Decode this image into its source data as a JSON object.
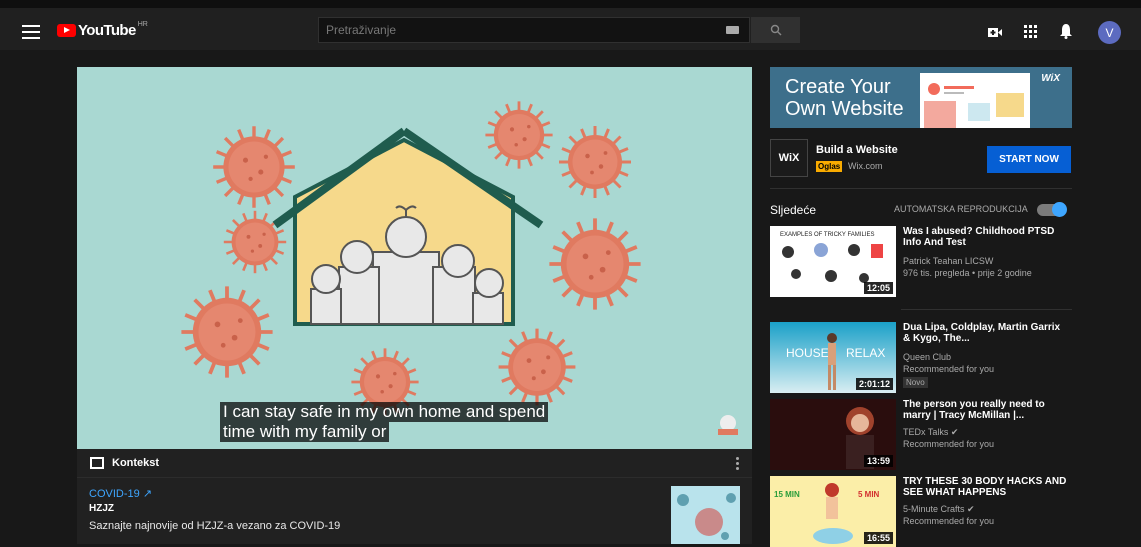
{
  "header": {
    "logo_text": "YouTube",
    "region": "HR",
    "search_placeholder": "Pretraživanje",
    "avatar_letter": "V",
    "icons": [
      "menu-icon",
      "keyboard-icon",
      "search-icon",
      "create-video-icon",
      "apps-icon",
      "notifications-icon"
    ]
  },
  "player": {
    "caption_line1": "I can stay safe in my own home and spend",
    "caption_line2": "time with my family or"
  },
  "context": {
    "heading": "Kontekst",
    "link": "COVID-19",
    "source": "HZJZ",
    "description": "Saznajte najnovije od HZJZ-a vezano za COVID-19"
  },
  "ad": {
    "banner_text": "Create Your Own Website",
    "banner_brand": "WiX",
    "logo_text": "WiX",
    "title": "Build a Website",
    "badge": "Oglas",
    "domain": "Wix.com",
    "cta": "START NOW"
  },
  "up_next": {
    "label": "Sljedeće",
    "autoplay_label": "AUTOMATSKA REPRODUKCIJA",
    "autoplay_on": true
  },
  "recommendations": [
    {
      "title": "Was I abused? Childhood PTSD Info And Test",
      "channel": "Patrick Teahan LICSW",
      "meta": "976 tis. pregleda • prije 2 godine",
      "duration": "12:05",
      "thumb_caption": "EXAMPLES OF TRICKY FAMILIES"
    },
    {
      "title": "Dua Lipa, Coldplay, Martin Garrix & Kygo, The...",
      "channel": "Queen Club",
      "meta": "Recommended for you",
      "badge": "Novo",
      "duration": "2:01:12",
      "thumb_left": "HOUSE",
      "thumb_right": "RELAX"
    },
    {
      "title": "The person you really need to marry | Tracy McMillan |...",
      "channel": "TEDx Talks",
      "meta": "Recommended for you",
      "duration": "13:59",
      "verified": true
    },
    {
      "title": "TRY THESE 30 BODY HACKS AND SEE WHAT HAPPENS",
      "channel": "5-Minute Crafts",
      "meta": "Recommended for you",
      "duration": "16:55",
      "verified": true,
      "thumb_left": "15 MIN",
      "thumb_right": "5 MIN"
    }
  ],
  "colors": {
    "accent_blue": "#3ea6ff",
    "cta_blue": "#065fd4",
    "youtube_red": "#ff0000",
    "background": "#181818",
    "video_bg": "#a9d8d2",
    "virus": "#e07a60",
    "house_fill": "#f6d98b",
    "house_roof": "#1f5c4e"
  }
}
